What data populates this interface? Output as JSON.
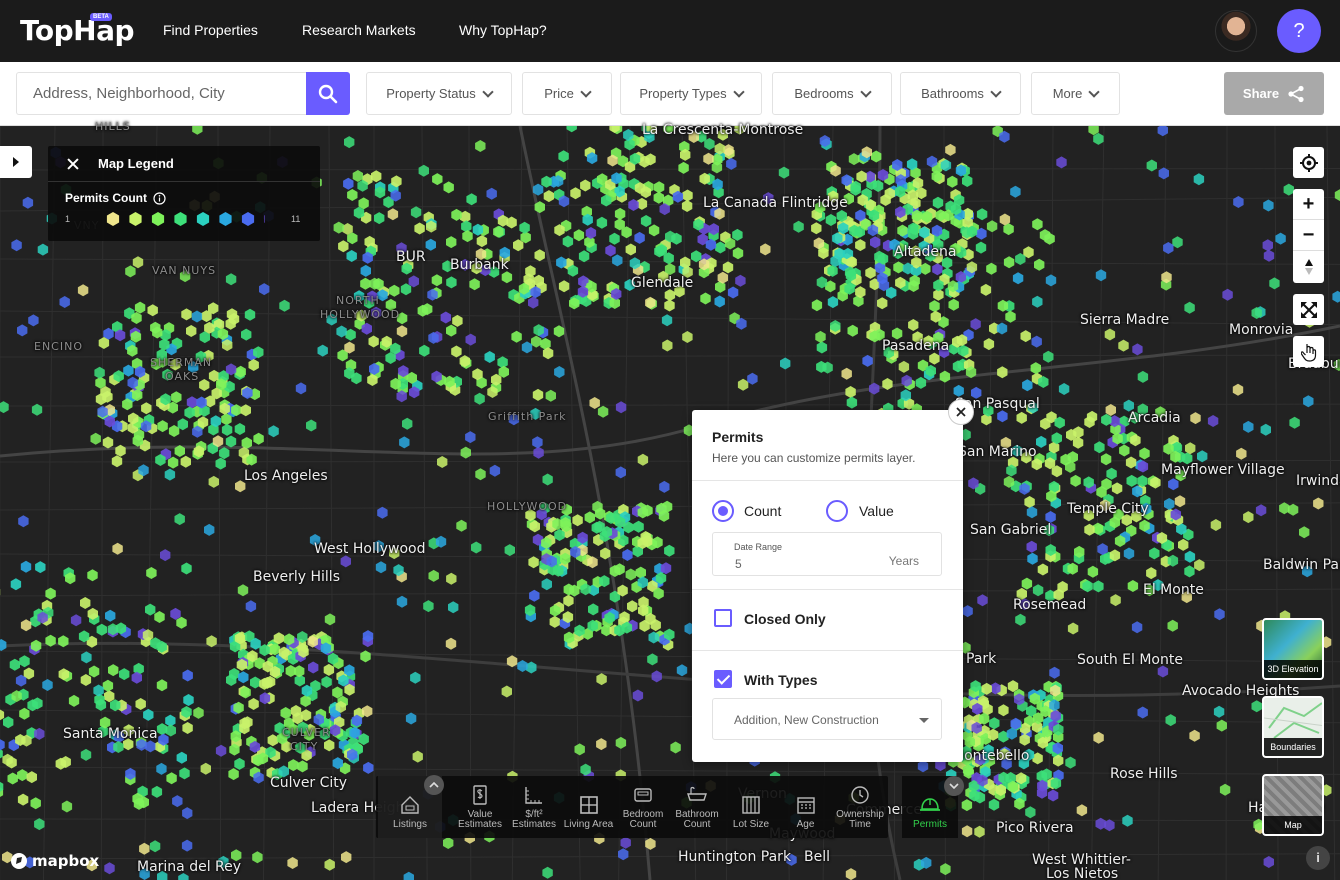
{
  "brand": {
    "logo": "TopHap",
    "badge": "BETA"
  },
  "nav": [
    "Find Properties",
    "Research Markets",
    "Why TopHap?"
  ],
  "help_label": "?",
  "search": {
    "placeholder": "Address, Neighborhood, City"
  },
  "filters": [
    "Property Status",
    "Price",
    "Property Types",
    "Bedrooms",
    "Bathrooms",
    "More"
  ],
  "share_label": "Share",
  "legend": {
    "title": "Map Legend",
    "subtitle": "Permits Count",
    "min": "1",
    "max": "11",
    "colors": [
      "#f0e68c",
      "#c9f26a",
      "#7ef25a",
      "#3de07a",
      "#2bd1c0",
      "#2aa8e0",
      "#4a6cf0",
      "#6a4cd8"
    ]
  },
  "places": [
    {
      "name": "La Crescenta-Montrose",
      "dim": false
    },
    {
      "name": "La Canada Flintridge",
      "dim": false
    },
    {
      "name": "Altadena",
      "dim": false
    },
    {
      "name": "Sierra Madre",
      "dim": false
    },
    {
      "name": "Monrovia",
      "dim": false
    },
    {
      "name": "Pasadena",
      "dim": false
    },
    {
      "name": "Glendale",
      "dim": false
    },
    {
      "name": "Burbank",
      "dim": false
    },
    {
      "name": "BUR",
      "dim": false
    },
    {
      "name": "VAN NUYS",
      "dim": true
    },
    {
      "name": "NORTH",
      "dim": true
    },
    {
      "name": "HOLLYWOOD",
      "dim": true
    },
    {
      "name": "ENCINO",
      "dim": true
    },
    {
      "name": "SHERMAN",
      "dim": true
    },
    {
      "name": "OAKS",
      "dim": true
    },
    {
      "name": "Griffith Park",
      "dim": true
    },
    {
      "name": "Los Angeles",
      "dim": false
    },
    {
      "name": "HOLLYWOOD",
      "dim": true
    },
    {
      "name": "West Hollywood",
      "dim": false
    },
    {
      "name": "Beverly Hills",
      "dim": false
    },
    {
      "name": "Santa Monica",
      "dim": false
    },
    {
      "name": "CULVER",
      "dim": true
    },
    {
      "name": "CITY",
      "dim": true
    },
    {
      "name": "Culver City",
      "dim": false
    },
    {
      "name": "Ladera Heights",
      "dim": false
    },
    {
      "name": "Marina del Rey",
      "dim": false
    },
    {
      "name": "Huntington Park",
      "dim": false
    },
    {
      "name": "Bell",
      "dim": false
    },
    {
      "name": "Maywood",
      "dim": false
    },
    {
      "name": "Commerce",
      "dim": false
    },
    {
      "name": "Pico Rivera",
      "dim": false
    },
    {
      "name": "West Whittier-",
      "dim": false
    },
    {
      "name": "Los Nietos",
      "dim": false
    },
    {
      "name": "Rose Hills",
      "dim": false
    },
    {
      "name": "Montebello",
      "dim": false
    },
    {
      "name": "Avocado Heights",
      "dim": false
    },
    {
      "name": "South El Monte",
      "dim": false
    },
    {
      "name": "Rosemead",
      "dim": false
    },
    {
      "name": "El Monte",
      "dim": false
    },
    {
      "name": "Baldwin Park",
      "dim": false
    },
    {
      "name": "San Gabriel",
      "dim": false
    },
    {
      "name": "Temple City",
      "dim": false
    },
    {
      "name": "Mayflower Village",
      "dim": false
    },
    {
      "name": "Irwindale",
      "dim": false
    },
    {
      "name": "Arcadia",
      "dim": false
    },
    {
      "name": "San Pasqual",
      "dim": false
    },
    {
      "name": "San Marino",
      "dim": false
    },
    {
      "name": "Bradbury",
      "dim": false
    },
    {
      "name": "HILLS",
      "dim": true
    },
    {
      "name": "VNY",
      "dim": true
    },
    {
      "name": "Vernon",
      "dim": false
    },
    {
      "name": "Park",
      "dim": false
    },
    {
      "name": "Hawthorne",
      "dim": false
    }
  ],
  "permits_panel": {
    "title": "Permits",
    "subtitle": "Here you can customize permits layer.",
    "radio_count": "Count",
    "radio_value": "Value",
    "date_range_label": "Date Range",
    "date_range_value": "5",
    "date_range_unit": "Years",
    "closed_only": "Closed Only",
    "with_types": "With Types",
    "types_value": "Addition, New Construction"
  },
  "layers": [
    {
      "label": "Listings",
      "icon": "sale-house-icon"
    },
    {
      "label": "Value Estimates",
      "icon": "dollar-doc-icon"
    },
    {
      "label": "$/ft² Estimates",
      "icon": "ruler-dollar-icon"
    },
    {
      "label": "Living Area",
      "icon": "floorplan-icon"
    },
    {
      "label": "Bedroom Count",
      "icon": "bed-icon"
    },
    {
      "label": "Bathroom Count",
      "icon": "bathtub-icon"
    },
    {
      "label": "Lot Size",
      "icon": "lot-grid-icon"
    },
    {
      "label": "Age",
      "icon": "calendar-icon"
    },
    {
      "label": "Ownership Time",
      "icon": "clock-icon"
    },
    {
      "label": "Permits",
      "icon": "hardhat-icon"
    }
  ],
  "thumbs": [
    "3D Elevation",
    "Boundaries",
    "Map"
  ],
  "attribution": "mapbox",
  "info_label": "i"
}
